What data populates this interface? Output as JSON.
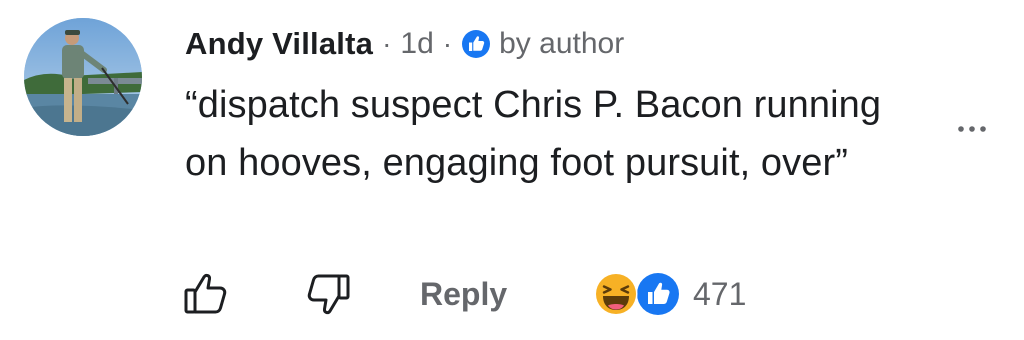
{
  "comment": {
    "author": "Andy Villalta",
    "separator": "·",
    "time": "1d",
    "author_badge_label": "by author",
    "text": "“dispatch suspect Chris P. Bacon running on hooves, engaging foot pursuit, over”",
    "more_icon": "more-horizontal-icon"
  },
  "actions": {
    "like_icon": "thumbs-up-outline-icon",
    "dislike_icon": "thumbs-down-outline-icon",
    "reply_label": "Reply",
    "reactions": [
      "haha",
      "like"
    ],
    "reaction_count": "471"
  },
  "colors": {
    "name": "#1c1e21",
    "secondary": "#65676b",
    "accent_blue": "#1877f2",
    "haha_yellow": "#f7b125"
  }
}
